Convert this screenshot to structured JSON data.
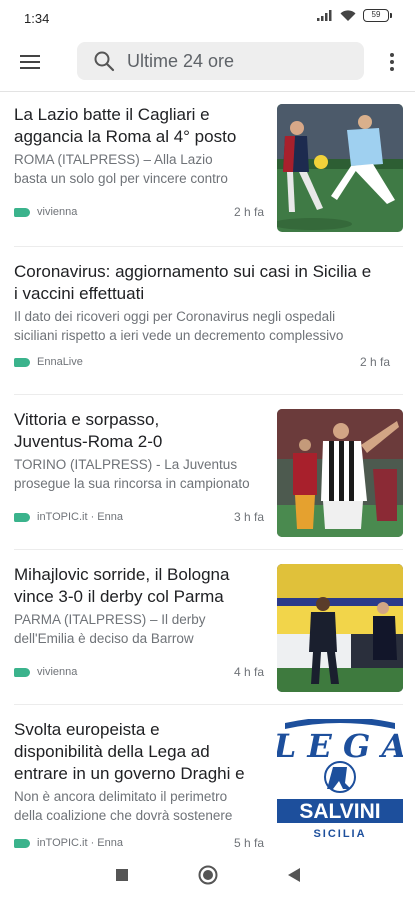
{
  "status_bar": {
    "time": "1:34",
    "battery": "59"
  },
  "search": {
    "text": "Ultime 24 ore"
  },
  "articles": [
    {
      "title_lines": [
        "La Lazio batte il Cagliari e",
        "aggancia la Roma al 4° posto"
      ],
      "snippet_lines": [
        "ROMA (ITALPRESS) – Alla Lazio",
        "basta un solo gol per vincere contro"
      ],
      "source": "vivienna",
      "time": "2 h fa",
      "image": "football-lazio-cagliari-photo"
    },
    {
      "title_lines": [
        "Coronavirus: aggiornamento sui casi in Sicilia e",
        "i vaccini effettuati"
      ],
      "snippet_lines": [
        "Il dato dei ricoveri oggi per Coronavirus negli ospedali",
        "siciliani rispetto a ieri vede un decremento complessivo"
      ],
      "source": "EnnaLive",
      "time": "2 h fa"
    },
    {
      "title_lines": [
        "Vittoria e sorpasso,",
        "Juventus-Roma 2-0"
      ],
      "snippet_lines": [
        "TORINO (ITALPRESS) - La Juventus",
        "prosegue la sua rincorsa in campionato"
      ],
      "source": "inTOPIC.it · Enna",
      "time": "3 h fa",
      "image": "football-juventus-roma-photo"
    },
    {
      "title_lines": [
        "Mihajlovic sorride, il Bologna",
        "vince 3-0 il derby col Parma"
      ],
      "snippet_lines": [
        "PARMA (ITALPRESS) – Il derby",
        "dell'Emilia è deciso da Barrow"
      ],
      "source": "vivienna",
      "time": "4 h fa",
      "image": "football-bologna-parma-photo"
    },
    {
      "title_lines": [
        "Svolta europeista e",
        "disponibilità della Lega ad",
        "entrare in un governo Draghi e"
      ],
      "snippet_lines": [
        "Non è ancora delimitato il perimetro",
        "della coalizione che dovrà sostenere"
      ],
      "source": "inTOPIC.it · Enna",
      "time": "5 h fa",
      "image": "lega-salvini-sicilia-logo",
      "logo_text": {
        "top": "LEGA",
        "middle": "SALVINI",
        "bottom": "SICILIA"
      }
    }
  ],
  "colors": {
    "source_tag": "#3bb38c",
    "search_bg": "#eeeeee",
    "lega_blue": "#1d4f9c"
  }
}
